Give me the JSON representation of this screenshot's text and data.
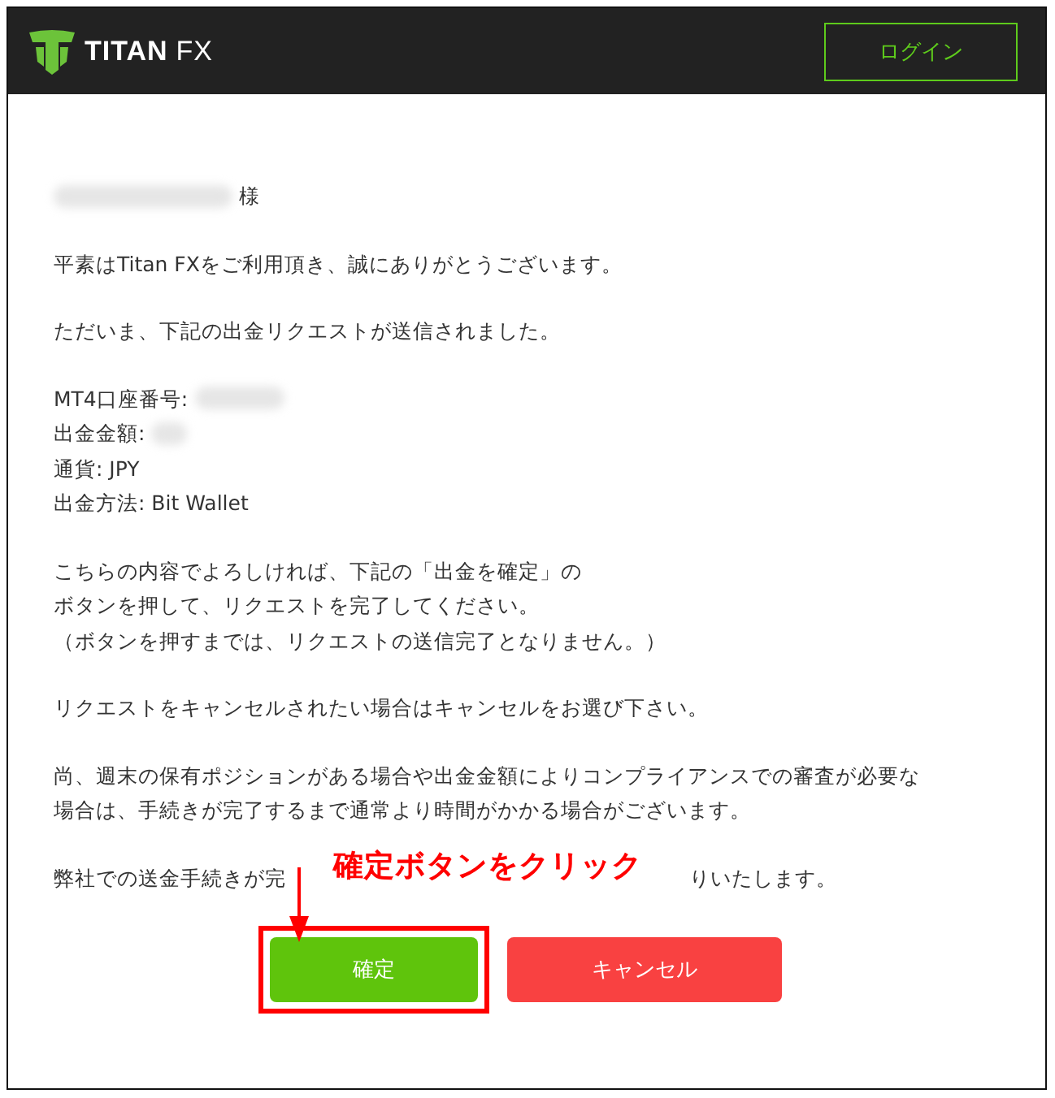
{
  "header": {
    "logo": [
      "TITAN",
      "FX"
    ],
    "login_button": "ログイン"
  },
  "email": {
    "salutation": {
      "redacted": true,
      "suffix": "様"
    },
    "blocks": [
      {
        "kind": "lines",
        "lines": [
          "平素はTitan FXをご利用頂き、誠にありがとうございます。"
        ]
      },
      {
        "kind": "lines",
        "lines": [
          "ただいま、下記の出金リクエストが送信されました。"
        ]
      },
      {
        "kind": "details",
        "rows": [
          {
            "text": "MT4口座番号:",
            "redacted": true
          },
          {
            "text": "出金金額:",
            "redacted": true
          },
          {
            "text": "通貨: JPY",
            "redacted": false
          },
          {
            "text": "出金方法: Bit Wallet",
            "redacted": false
          }
        ]
      },
      {
        "kind": "lines",
        "lines": [
          "こちらの内容でよろしければ、下記の「出金を確定」の",
          "ボタンを押して、リクエストを完了してください。",
          "（ボタンを押すまでは、リクエストの送信完了となりません。）"
        ]
      },
      {
        "kind": "lines",
        "lines": [
          "リクエストをキャンセルされたい場合はキャンセルをお選び下さい。"
        ]
      },
      {
        "kind": "lines",
        "lines": [
          "尚、週末の保有ポジションがある場合や出金金額によりコンプライアンスでの審査が必要な",
          "場合は、手続きが完了するまで通常より時間がかかる場合がございます。"
        ]
      }
    ],
    "closing_parts": [
      "弊社での送金手続きが完",
      "りいたします。"
    ],
    "buttons": [
      {
        "label": "確定",
        "kind": "confirm",
        "highlighted": true
      },
      {
        "label": "キャンセル",
        "kind": "cancel",
        "highlighted": false
      }
    ]
  },
  "annotation": {
    "text": "確定ボタンをクリック"
  }
}
